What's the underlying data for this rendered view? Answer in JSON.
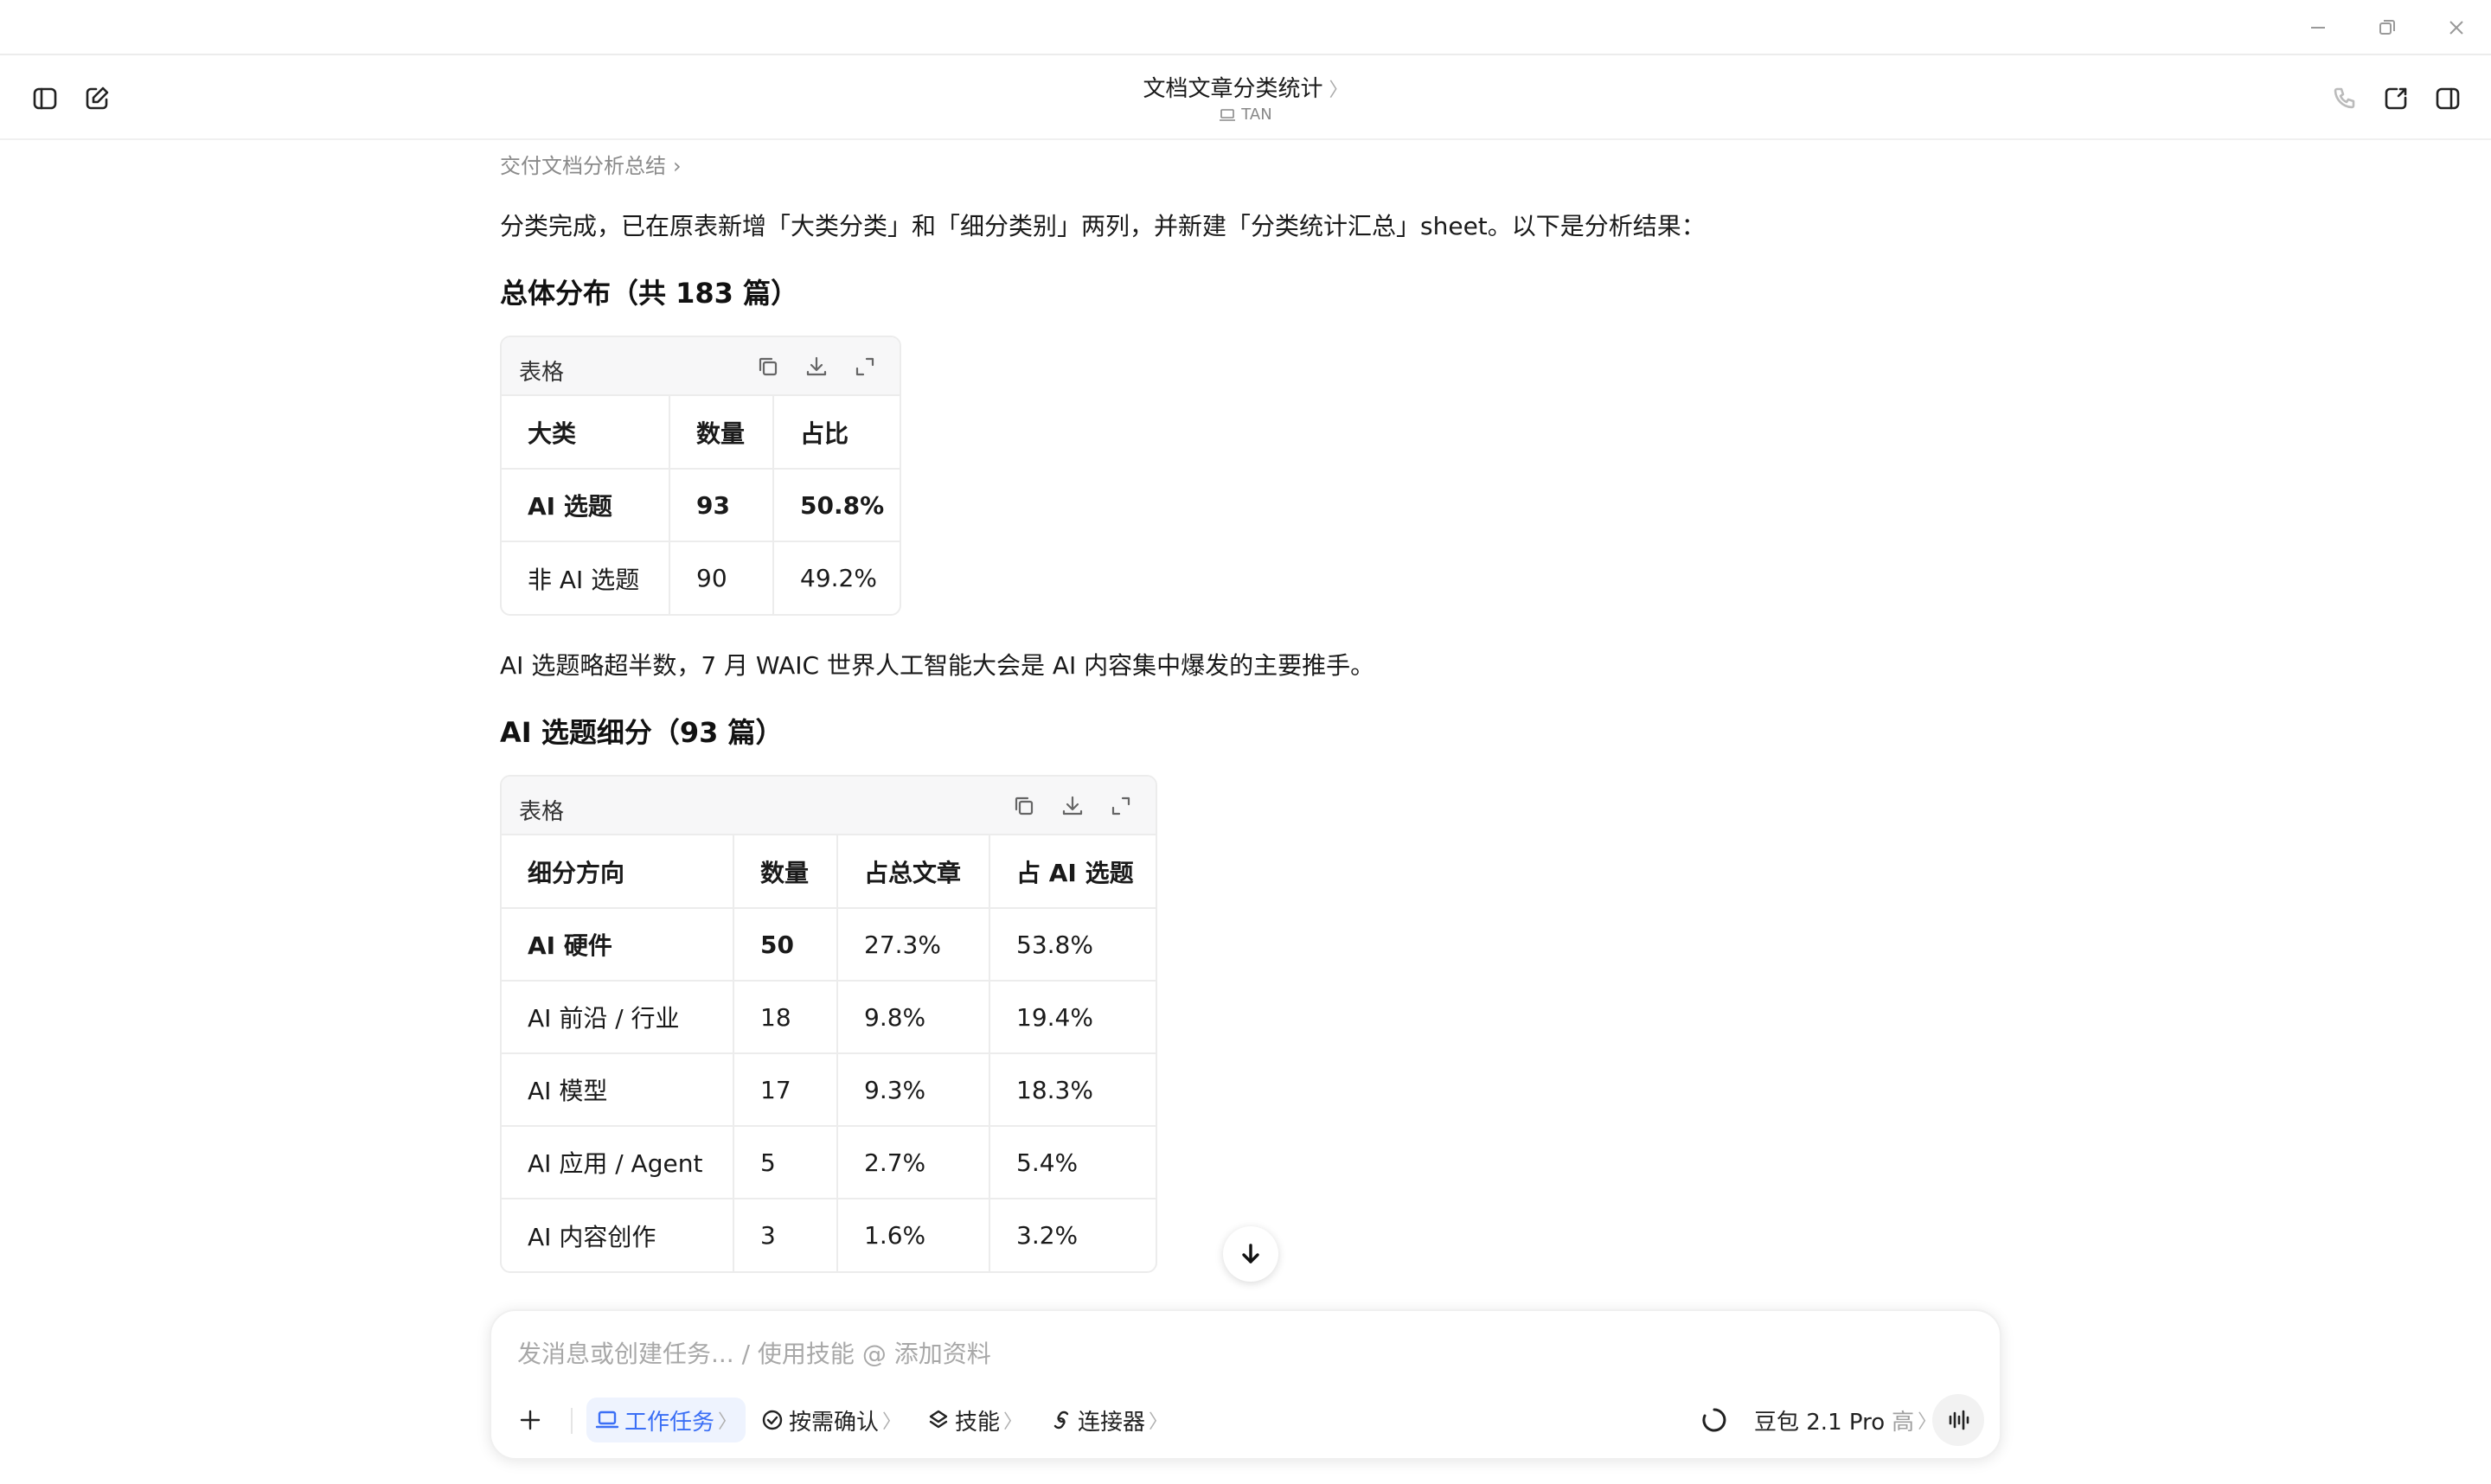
{
  "window": {
    "title": "文档文章分类统计",
    "subtitle": "TAN"
  },
  "breadcrumb": "交付文档分析总结",
  "intro": "分类完成，已在原表新增「大类分类」和「细分类别」两列，并新建「分类统计汇总」sheet。以下是分析结果：",
  "section1": {
    "heading": "总体分布（共 183 篇）",
    "table_label": "表格",
    "columns": [
      "大类",
      "数量",
      "占比"
    ],
    "rows": [
      [
        "AI 选题",
        "93",
        "50.8%"
      ],
      [
        "非 AI 选题",
        "90",
        "49.2%"
      ]
    ]
  },
  "note": "AI 选题略超半数，7 月 WAIC 世界人工智能大会是 AI 内容集中爆发的主要推手。",
  "section2": {
    "heading": "AI 选题细分（93 篇）",
    "table_label": "表格",
    "columns": [
      "细分方向",
      "数量",
      "占总文章",
      "占 AI 选题"
    ],
    "rows": [
      [
        "AI 硬件",
        "50",
        "27.3%",
        "53.8%"
      ],
      [
        "AI 前沿 / 行业",
        "18",
        "9.8%",
        "19.4%"
      ],
      [
        "AI 模型",
        "17",
        "9.3%",
        "18.3%"
      ],
      [
        "AI 应用 / Agent",
        "5",
        "2.7%",
        "5.4%"
      ],
      [
        "AI 内容创作",
        "3",
        "1.6%",
        "3.2%"
      ]
    ]
  },
  "composer": {
    "placeholder": "发消息或创建任务... / 使用技能 @ 添加资料",
    "work_task": "工作任务",
    "confirm": "按需确认",
    "skills": "技能",
    "connectors": "连接器",
    "model": "豆包 2.1 Pro",
    "model_level": "高"
  },
  "colors": {
    "accent": "#3b6ff5",
    "border": "#ececec"
  }
}
